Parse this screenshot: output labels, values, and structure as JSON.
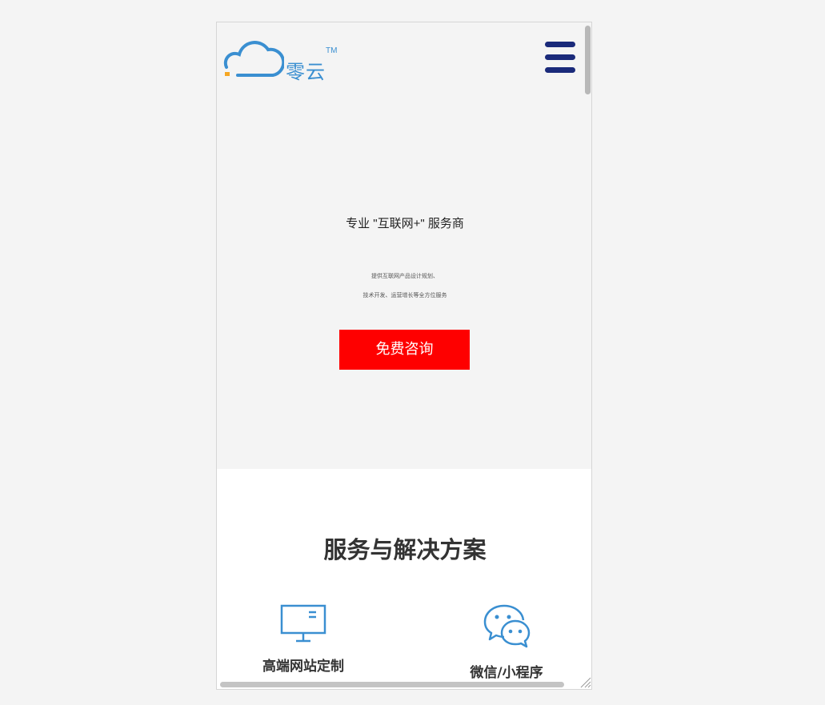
{
  "brand": {
    "name": "零云",
    "trademark": "TM",
    "colors": {
      "primary": "#3a8fd1",
      "accent": "#f5a623"
    }
  },
  "header": {
    "menu_icon": "hamburger-menu-icon",
    "menu_color": "#1a2a7a"
  },
  "hero": {
    "title": "专业 \"互联网+\" 服务商",
    "subtitle_line1": "提供互联网产品设计规划、",
    "subtitle_line2": "技术开发、运营增长等全方位服务",
    "cta_label": "免费咨询",
    "cta_color": "#fe0000"
  },
  "services": {
    "title": "服务与解决方案",
    "items": [
      {
        "label": "高端网站定制",
        "icon": "monitor-icon"
      },
      {
        "label": "微信/小程序",
        "icon": "wechat-icon"
      }
    ]
  }
}
